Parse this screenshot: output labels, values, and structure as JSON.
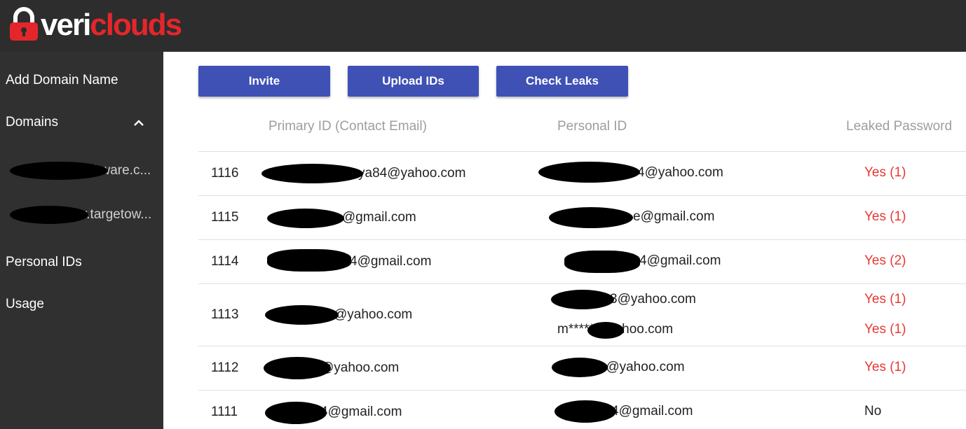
{
  "brand": {
    "logo_text_white": "veri",
    "logo_text_red": "clouds",
    "accent": "#e4262b"
  },
  "sidebar": {
    "items": [
      {
        "label": "Add Domain Name"
      },
      {
        "label": "Domains"
      },
      {
        "label": "Personal IDs"
      },
      {
        "label": "Usage"
      }
    ],
    "domains": [
      {
        "visible_fragment": "ltware.c..."
      },
      {
        "visible_fragment": "r.targetow..."
      }
    ]
  },
  "toolbar": {
    "invite_label": "Invite",
    "upload_label": "Upload IDs",
    "check_label": "Check Leaks",
    "button_color": "#3f51b5"
  },
  "table": {
    "headers": {
      "primary": "Primary ID (Contact Email)",
      "personal": "Personal ID",
      "leaked": "Leaked Password"
    },
    "rows": [
      {
        "id": "1116",
        "primary": "ya84@yahoo.com",
        "personal": [
          "4@yahoo.com"
        ],
        "leaked": [
          "Yes (1)"
        ]
      },
      {
        "id": "1115",
        "primary": "re@gmail.com",
        "personal": [
          "e@gmail.com"
        ],
        "leaked": [
          "Yes (1)"
        ]
      },
      {
        "id": "1114",
        "primary": "4@gmail.com",
        "personal": [
          "4@gmail.com"
        ],
        "leaked": [
          "Yes (2)"
        ]
      },
      {
        "id": "1113",
        "primary": "@yahoo.com",
        "personal": [
          "3@yahoo.com",
          "m*****@yahoo.com"
        ],
        "leaked": [
          "Yes (1)",
          "Yes (1)"
        ]
      },
      {
        "id": "1112",
        "primary": "@yahoo.com",
        "personal": [
          "r@yahoo.com"
        ],
        "leaked": [
          "Yes (1)"
        ]
      },
      {
        "id": "1111",
        "primary": "4@gmail.com",
        "personal": [
          "4@gmail.com"
        ],
        "leaked": [
          "No"
        ]
      }
    ]
  }
}
